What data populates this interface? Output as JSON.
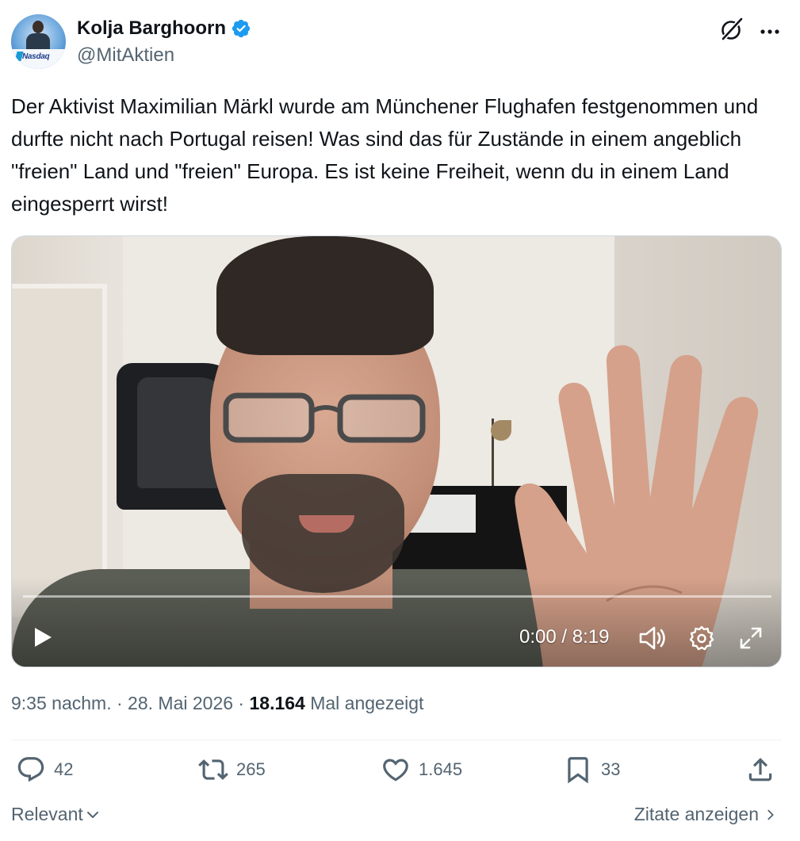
{
  "author": {
    "display_name": "Kolja Barghoorn",
    "handle": "@MitAktien",
    "avatar_logo_text": "Nasdaq"
  },
  "tweet": {
    "text": "Der Aktivist Maximilian Märkl wurde am Münchener Flughafen festgenommen und durfte nicht nach Portugal reisen! Was sind das für Zustände in einem angeblich \"freien\" Land und \"freien\" Europa. Es ist keine Freiheit, wenn du in einem Land eingesperrt wirst!"
  },
  "video": {
    "time_display": "0:00 / 8:19",
    "progress": 0.0
  },
  "meta": {
    "time": "9:35 nachm.",
    "separator": "·",
    "date": "28. Mai 2026",
    "views": "18.164",
    "views_label": "Mal angezeigt"
  },
  "actions": {
    "replies": "42",
    "reposts": "265",
    "likes": "1.645",
    "bookmarks": "33"
  },
  "footer": {
    "sort_label": "Relevant",
    "quotes_label": "Zitate anzeigen"
  },
  "colors": {
    "text_primary": "#0f1419",
    "text_secondary": "#536471",
    "verified_blue": "#1d9bf0",
    "divider": "#eff3f4"
  },
  "icons": [
    "verified-badge-icon",
    "grok-icon",
    "more-icon",
    "play-icon",
    "volume-icon",
    "settings-icon",
    "fullscreen-icon",
    "reply-icon",
    "repost-icon",
    "like-icon",
    "bookmark-icon",
    "share-icon",
    "chevron-down-icon",
    "chevron-right-icon"
  ]
}
